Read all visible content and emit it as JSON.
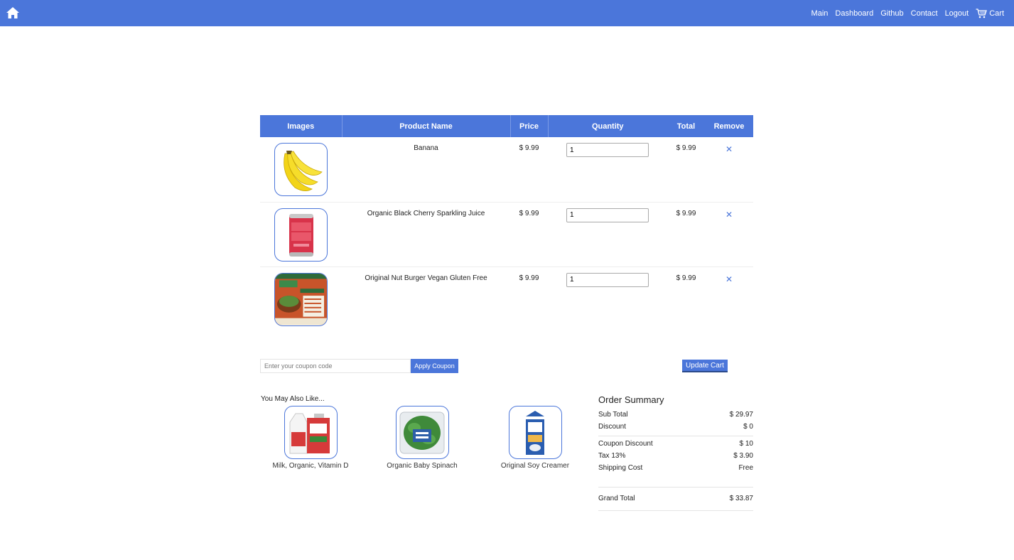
{
  "nav": {
    "links": [
      "Main",
      "Dashboard",
      "Github",
      "Contact",
      "Logout"
    ],
    "cart_label": "Cart"
  },
  "table": {
    "headers": [
      "Images",
      "Product Name",
      "Price",
      "Quantity",
      "Total",
      "Remove"
    ],
    "rows": [
      {
        "name": "Banana",
        "price": "$ 9.99",
        "quantity": "1",
        "total": "$ 9.99",
        "remove": "✕",
        "image": "banana"
      },
      {
        "name": "Organic Black Cherry Sparkling Juice",
        "price": "$ 9.99",
        "quantity": "1",
        "total": "$ 9.99",
        "remove": "✕",
        "image": "soda-can"
      },
      {
        "name": "Original Nut Burger Vegan Gluten Free",
        "price": "$ 9.99",
        "quantity": "1",
        "total": "$ 9.99",
        "remove": "✕",
        "image": "nut-burger-box"
      }
    ]
  },
  "coupon": {
    "placeholder": "Enter your coupon code",
    "apply_label": "Apply Coupon"
  },
  "update_label": "Update Cart",
  "recommendations": {
    "title": "You May Also Like...",
    "items": [
      {
        "name": "Milk, Organic, Vitamin D",
        "image": "milk-jugs"
      },
      {
        "name": "Organic Baby Spinach",
        "image": "spinach-box"
      },
      {
        "name": "Original Soy Creamer",
        "image": "soy-creamer-carton"
      }
    ]
  },
  "summary": {
    "title": "Order Summary",
    "sub_total_label": "Sub Total",
    "sub_total": "$ 29.97",
    "discount_label": "Discount",
    "discount": "$ 0",
    "coupon_discount_label": "Coupon Discount",
    "coupon_discount": "$ 10",
    "tax_label": "Tax 13%",
    "tax": "$ 3.90",
    "shipping_label": "Shipping Cost",
    "shipping": "Free",
    "grand_total_label": "Grand Total",
    "grand_total": "$ 33.87"
  },
  "colors": {
    "accent": "#4b76da"
  }
}
